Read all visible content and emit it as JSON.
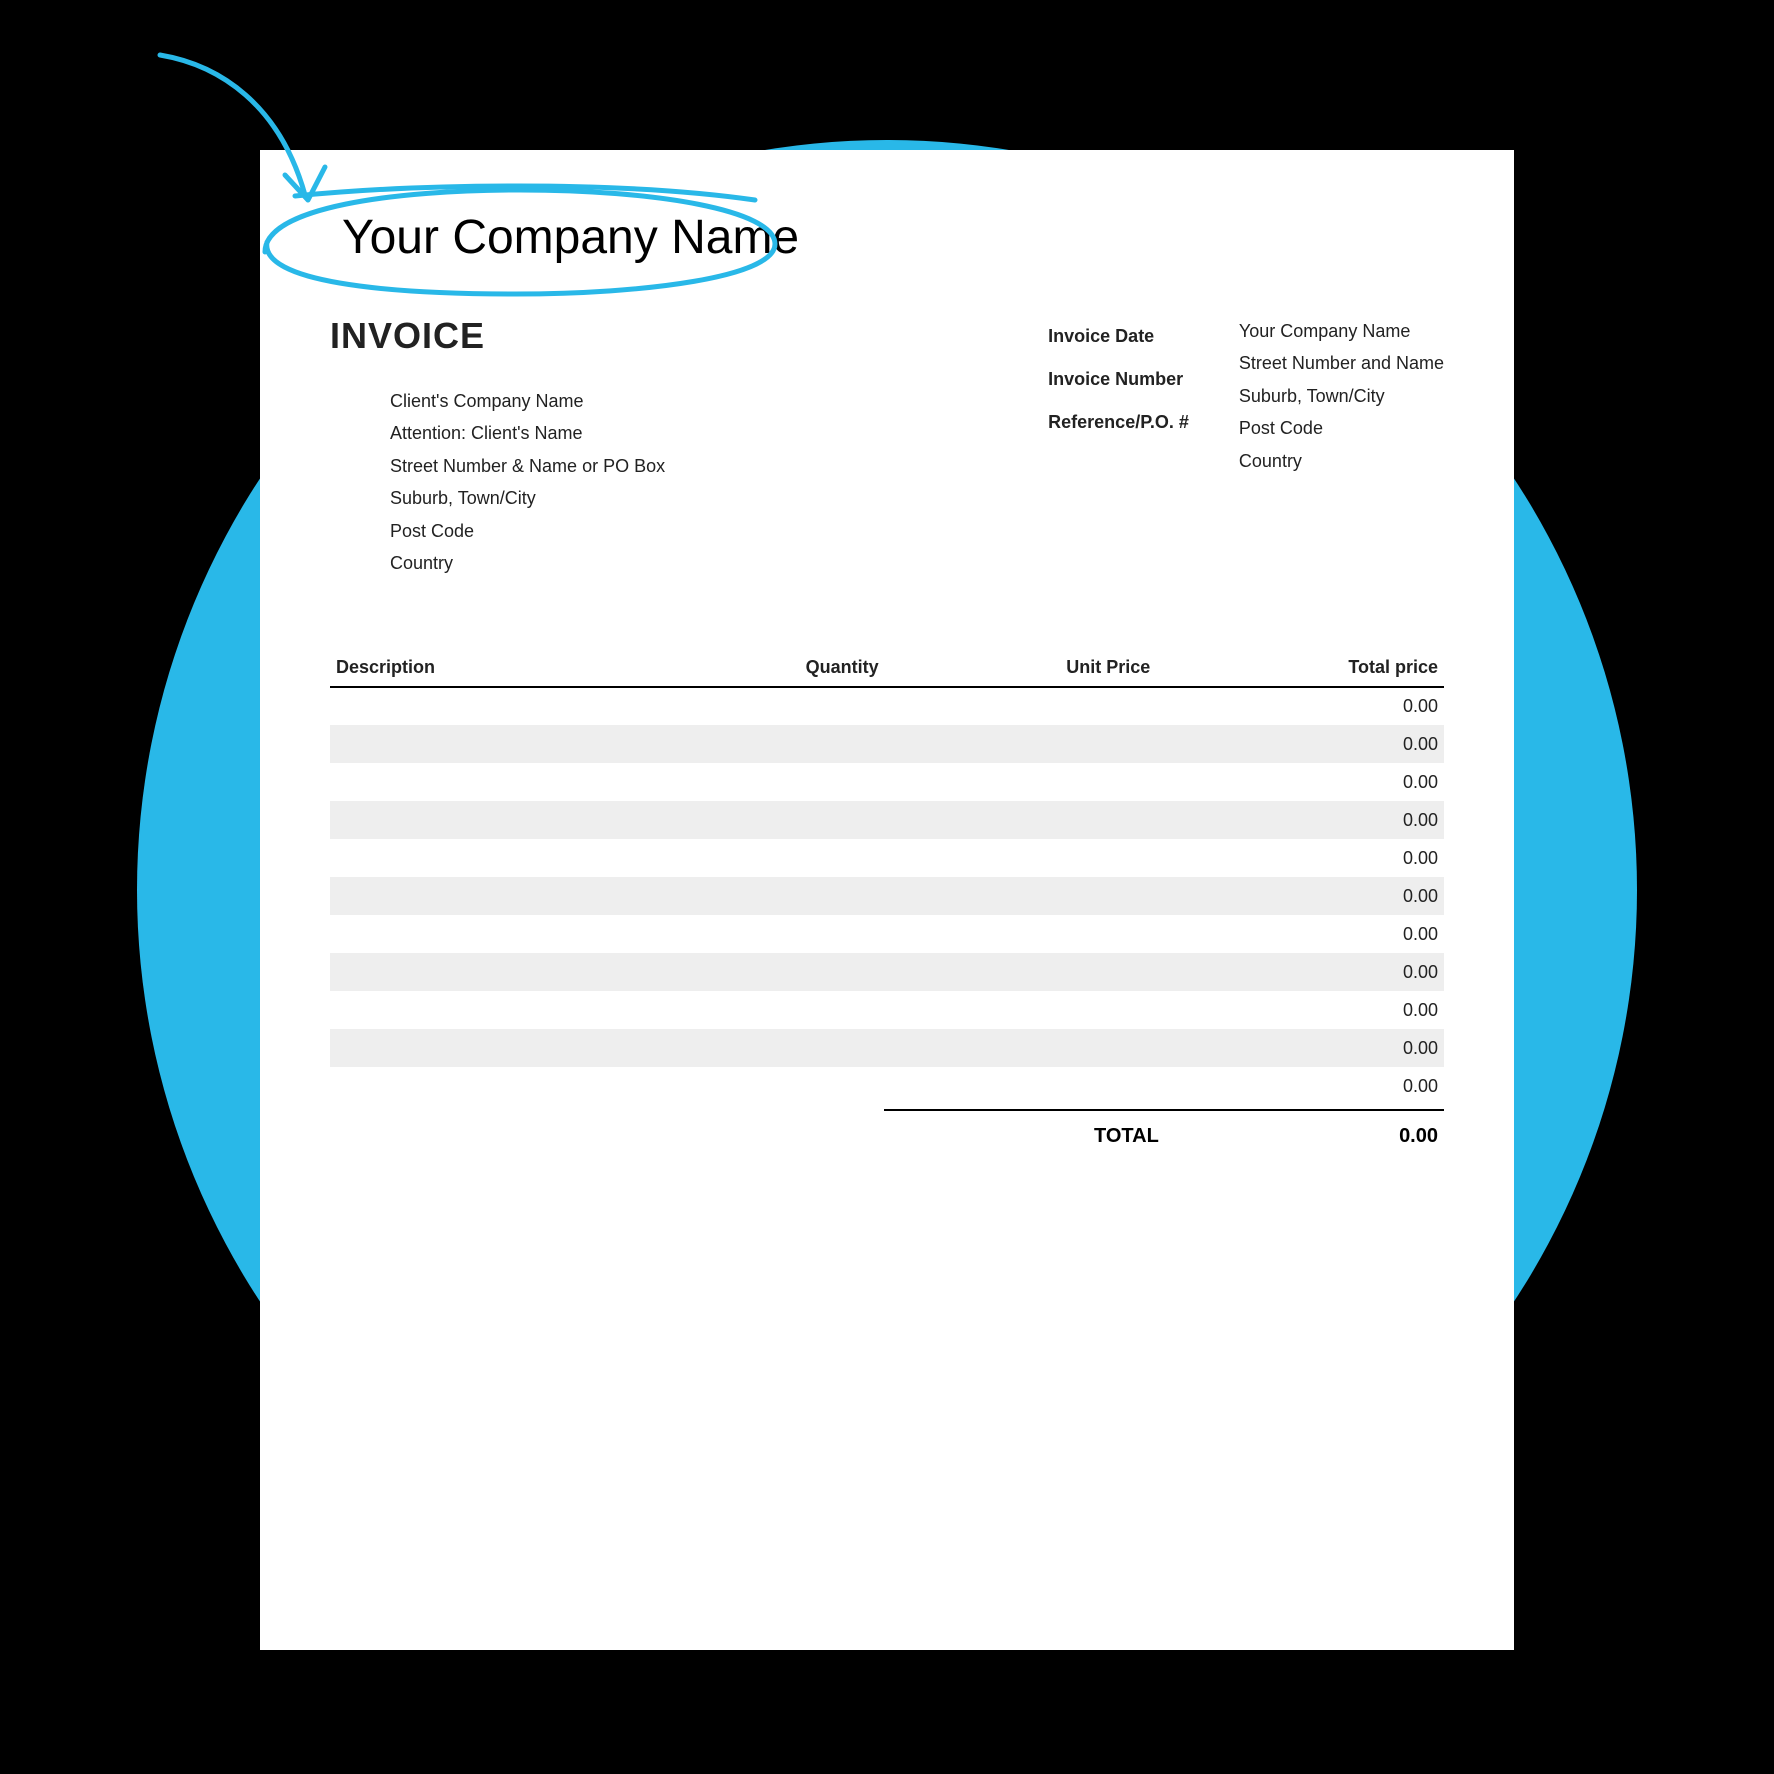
{
  "header": {
    "company_name": "Your Company Name",
    "title": "INVOICE"
  },
  "client": {
    "line1": "Client's Company Name",
    "line2": "Attention: Client's Name",
    "line3": "Street Number & Name or PO Box",
    "line4": "Suburb, Town/City",
    "line5": "Post Code",
    "line6": "Country"
  },
  "meta": {
    "date_label": "Invoice Date",
    "number_label": "Invoice Number",
    "reference_label": "Reference/P.O. #"
  },
  "sender": {
    "line1": "Your Company Name",
    "line2": "Street Number and Name",
    "line3": "Suburb, Town/City",
    "line4": "Post Code",
    "line5": "Country"
  },
  "columns": {
    "description": "Description",
    "quantity": "Quantity",
    "unit_price": "Unit Price",
    "total_price": "Total price"
  },
  "rows": [
    {
      "total": "0.00"
    },
    {
      "total": "0.00"
    },
    {
      "total": "0.00"
    },
    {
      "total": "0.00"
    },
    {
      "total": "0.00"
    },
    {
      "total": "0.00"
    },
    {
      "total": "0.00"
    },
    {
      "total": "0.00"
    },
    {
      "total": "0.00"
    },
    {
      "total": "0.00"
    },
    {
      "total": "0.00"
    }
  ],
  "totals": {
    "label": "TOTAL",
    "value": "0.00"
  }
}
